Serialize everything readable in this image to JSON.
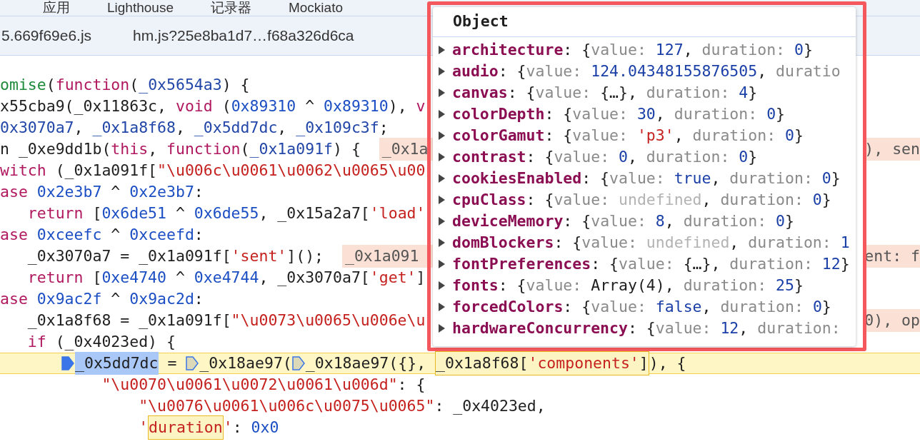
{
  "panel_tabs": [
    {
      "label": "应用"
    },
    {
      "label": "Lighthouse"
    },
    {
      "label": "记录器"
    },
    {
      "label": "Mockiato"
    }
  ],
  "file_tabs": [
    {
      "label": "5.669f69e6.js"
    },
    {
      "label": "hm.js?25e8ba1d7…f68a326d6ca"
    }
  ],
  "code_lines": [
    {
      "current": false,
      "tokens": [
        {
          "text": "omise",
          "kind": "func"
        },
        {
          "text": "(",
          "kind": "plain"
        },
        {
          "text": "function",
          "kind": "keyword"
        },
        {
          "text": "(",
          "kind": "plain"
        },
        {
          "text": "_0x5654a3",
          "kind": "def"
        },
        {
          "text": ") {",
          "kind": "plain"
        }
      ]
    },
    {
      "current": false,
      "tokens": [
        {
          "text": "x55cba9(_0x11863c, ",
          "kind": "plain"
        },
        {
          "text": "void",
          "kind": "keyword"
        },
        {
          "text": " (",
          "kind": "plain"
        },
        {
          "text": "0x89310",
          "kind": "number"
        },
        {
          "text": " ^ ",
          "kind": "plain"
        },
        {
          "text": "0x89310",
          "kind": "number"
        },
        {
          "text": "), ",
          "kind": "plain"
        },
        {
          "text": "v",
          "kind": "keyword"
        }
      ]
    },
    {
      "current": false,
      "tokens": [
        {
          "text": "0x3070a7",
          "kind": "def"
        },
        {
          "text": ", ",
          "kind": "plain"
        },
        {
          "text": "_0x1a8f68",
          "kind": "def"
        },
        {
          "text": ", ",
          "kind": "plain"
        },
        {
          "text": "_0x5dd7dc",
          "kind": "def"
        },
        {
          "text": ", ",
          "kind": "plain"
        },
        {
          "text": "_0x109c3f",
          "kind": "def"
        },
        {
          "text": ";",
          "kind": "plain"
        }
      ]
    },
    {
      "current": false,
      "tokens": [
        {
          "text": "n _0xe9dd1b(",
          "kind": "plain"
        },
        {
          "text": "this",
          "kind": "keyword"
        },
        {
          "text": ", ",
          "kind": "plain"
        },
        {
          "text": "function",
          "kind": "keyword"
        },
        {
          "text": "(",
          "kind": "plain"
        },
        {
          "text": "_0x1a091f",
          "kind": "def"
        },
        {
          "text": ") {  ",
          "kind": "plain"
        },
        {
          "text": "_0x1a",
          "kind": "inline"
        }
      ],
      "right": "), sen"
    },
    {
      "current": false,
      "tokens": [
        {
          "text": "witch",
          "kind": "keyword"
        },
        {
          "text": " (_0x1a091f[",
          "kind": "plain"
        },
        {
          "text": "\"\\u006c\\u0061\\u0062\\u0065\\u00",
          "kind": "string"
        }
      ]
    },
    {
      "current": false,
      "tokens": [
        {
          "text": "ase",
          "kind": "keyword"
        },
        {
          "text": " 0x2e3b7",
          "kind": "number"
        },
        {
          "text": " ^ ",
          "kind": "plain"
        },
        {
          "text": "0x2e3b7",
          "kind": "number"
        },
        {
          "text": ":",
          "kind": "plain"
        }
      ]
    },
    {
      "current": false,
      "tokens": [
        {
          "text": "   return",
          "kind": "keyword"
        },
        {
          "text": " [",
          "kind": "plain"
        },
        {
          "text": "0x6de51",
          "kind": "number"
        },
        {
          "text": " ^ ",
          "kind": "plain"
        },
        {
          "text": "0x6de55",
          "kind": "number"
        },
        {
          "text": ", _0x15a2a7[",
          "kind": "plain"
        },
        {
          "text": "'load'",
          "kind": "string"
        }
      ]
    },
    {
      "current": false,
      "tokens": [
        {
          "text": "ase",
          "kind": "keyword"
        },
        {
          "text": " 0xceefc",
          "kind": "number"
        },
        {
          "text": " ^ ",
          "kind": "plain"
        },
        {
          "text": "0xceefd",
          "kind": "number"
        },
        {
          "text": ":",
          "kind": "plain"
        }
      ]
    },
    {
      "current": false,
      "tokens": [
        {
          "text": "   _0x3070a7 = _0x1a091f[",
          "kind": "plain"
        },
        {
          "text": "'sent'",
          "kind": "string"
        },
        {
          "text": "]();  ",
          "kind": "plain"
        },
        {
          "text": "_0x1a091",
          "kind": "inline"
        }
      ],
      "right": "ent: f"
    },
    {
      "current": false,
      "tokens": [
        {
          "text": "   return",
          "kind": "keyword"
        },
        {
          "text": " [",
          "kind": "plain"
        },
        {
          "text": "0xe4740",
          "kind": "number"
        },
        {
          "text": " ^ ",
          "kind": "plain"
        },
        {
          "text": "0xe4744",
          "kind": "number"
        },
        {
          "text": ", _0x3070a7[",
          "kind": "plain"
        },
        {
          "text": "'get'",
          "kind": "string"
        },
        {
          "text": "]",
          "kind": "plain"
        }
      ]
    },
    {
      "current": false,
      "tokens": [
        {
          "text": "ase",
          "kind": "keyword"
        },
        {
          "text": " 0x9ac2f",
          "kind": "number"
        },
        {
          "text": " ^ ",
          "kind": "plain"
        },
        {
          "text": "0x9ac2d",
          "kind": "number"
        },
        {
          "text": ":",
          "kind": "plain"
        }
      ]
    },
    {
      "current": false,
      "tokens": [
        {
          "text": "   _0x1a8f68 = _0x1a091f[",
          "kind": "plain"
        },
        {
          "text": "\"\\u0073\\u0065\\u006e\\u",
          "kind": "string"
        }
      ],
      "right": "0), op"
    },
    {
      "current": false,
      "tokens": [
        {
          "text": "   if",
          "kind": "keyword"
        },
        {
          "text": " (_0x4023ed) {",
          "kind": "plain"
        }
      ]
    },
    {
      "current": true,
      "tokens": [
        {
          "kind": "exec-marker"
        },
        {
          "text": "_0x5dd7dc",
          "kind": "selected"
        },
        {
          "text": " = ",
          "kind": "plain"
        },
        {
          "kind": "marker"
        },
        {
          "text": "_0x18ae97(",
          "kind": "plain"
        },
        {
          "kind": "marker"
        },
        {
          "text": "_0x18ae97({}, ",
          "kind": "plain"
        },
        {
          "kind": "box",
          "tokens": [
            {
              "text": "_0x1a8f68[",
              "kind": "plain"
            },
            {
              "text": "'components'",
              "kind": "string"
            },
            {
              "text": "]",
              "kind": "plain"
            }
          ]
        },
        {
          "text": "), {",
          "kind": "plain"
        }
      ]
    },
    {
      "current": false,
      "tokens": [
        {
          "text": "           \"\\u0070\\u0061\\u0072\\u0061\\u006d\"",
          "kind": "string"
        },
        {
          "text": ": {",
          "kind": "plain"
        }
      ]
    },
    {
      "current": false,
      "tokens": [
        {
          "text": "               \"\\u0076\\u0061\\u006c\\u0075\\u0065\"",
          "kind": "string"
        },
        {
          "text": ": _0x4023ed,",
          "kind": "plain"
        }
      ]
    },
    {
      "current": false,
      "tokens": [
        {
          "text": "               '",
          "kind": "string"
        },
        {
          "kind": "box",
          "tokens": [
            {
              "text": "duration",
              "kind": "string"
            }
          ]
        },
        {
          "text": "'",
          "kind": "string"
        },
        {
          "text": ": ",
          "kind": "plain"
        },
        {
          "text": "0x0",
          "kind": "number"
        }
      ]
    }
  ],
  "popover": {
    "title": "Object",
    "rows": [
      {
        "name": "architecture",
        "tokens": [
          {
            "text": ": {",
            "kind": "plain"
          },
          {
            "text": "value: ",
            "kind": "grey"
          },
          {
            "text": "127",
            "kind": "num"
          },
          {
            "text": ", ",
            "kind": "plain"
          },
          {
            "text": "duration: ",
            "kind": "grey"
          },
          {
            "text": "0",
            "kind": "num"
          },
          {
            "text": "}",
            "kind": "plain"
          }
        ]
      },
      {
        "name": "audio",
        "tokens": [
          {
            "text": ": {",
            "kind": "plain"
          },
          {
            "text": "value: ",
            "kind": "grey"
          },
          {
            "text": "124.04348155876505",
            "kind": "num"
          },
          {
            "text": ", ",
            "kind": "plain"
          },
          {
            "text": "duratio",
            "kind": "grey"
          }
        ]
      },
      {
        "name": "canvas",
        "tokens": [
          {
            "text": ": {",
            "kind": "plain"
          },
          {
            "text": "value: ",
            "kind": "grey"
          },
          {
            "text": "{…}",
            "kind": "plain"
          },
          {
            "text": ", ",
            "kind": "plain"
          },
          {
            "text": "duration: ",
            "kind": "grey"
          },
          {
            "text": "4",
            "kind": "num"
          },
          {
            "text": "}",
            "kind": "plain"
          }
        ]
      },
      {
        "name": "colorDepth",
        "tokens": [
          {
            "text": ": {",
            "kind": "plain"
          },
          {
            "text": "value: ",
            "kind": "grey"
          },
          {
            "text": "30",
            "kind": "num"
          },
          {
            "text": ", ",
            "kind": "plain"
          },
          {
            "text": "duration: ",
            "kind": "grey"
          },
          {
            "text": "0",
            "kind": "num"
          },
          {
            "text": "}",
            "kind": "plain"
          }
        ]
      },
      {
        "name": "colorGamut",
        "tokens": [
          {
            "text": ": {",
            "kind": "plain"
          },
          {
            "text": "value: ",
            "kind": "grey"
          },
          {
            "text": "'p3'",
            "kind": "str"
          },
          {
            "text": ", ",
            "kind": "plain"
          },
          {
            "text": "duration: ",
            "kind": "grey"
          },
          {
            "text": "0",
            "kind": "num"
          },
          {
            "text": "}",
            "kind": "plain"
          }
        ]
      },
      {
        "name": "contrast",
        "tokens": [
          {
            "text": ": {",
            "kind": "plain"
          },
          {
            "text": "value: ",
            "kind": "grey"
          },
          {
            "text": "0",
            "kind": "num"
          },
          {
            "text": ", ",
            "kind": "plain"
          },
          {
            "text": "duration: ",
            "kind": "grey"
          },
          {
            "text": "0",
            "kind": "num"
          },
          {
            "text": "}",
            "kind": "plain"
          }
        ]
      },
      {
        "name": "cookiesEnabled",
        "tokens": [
          {
            "text": ": {",
            "kind": "plain"
          },
          {
            "text": "value: ",
            "kind": "grey"
          },
          {
            "text": "true",
            "kind": "num"
          },
          {
            "text": ", ",
            "kind": "plain"
          },
          {
            "text": "duration: ",
            "kind": "grey"
          },
          {
            "text": "0",
            "kind": "num"
          },
          {
            "text": "}",
            "kind": "plain"
          }
        ]
      },
      {
        "name": "cpuClass",
        "tokens": [
          {
            "text": ": {",
            "kind": "plain"
          },
          {
            "text": "value: ",
            "kind": "grey"
          },
          {
            "text": "undefined",
            "kind": "undef"
          },
          {
            "text": ", ",
            "kind": "plain"
          },
          {
            "text": "duration: ",
            "kind": "grey"
          },
          {
            "text": "0",
            "kind": "num"
          },
          {
            "text": "}",
            "kind": "plain"
          }
        ]
      },
      {
        "name": "deviceMemory",
        "tokens": [
          {
            "text": ": {",
            "kind": "plain"
          },
          {
            "text": "value: ",
            "kind": "grey"
          },
          {
            "text": "8",
            "kind": "num"
          },
          {
            "text": ", ",
            "kind": "plain"
          },
          {
            "text": "duration: ",
            "kind": "grey"
          },
          {
            "text": "0",
            "kind": "num"
          },
          {
            "text": "}",
            "kind": "plain"
          }
        ]
      },
      {
        "name": "domBlockers",
        "tokens": [
          {
            "text": ": {",
            "kind": "plain"
          },
          {
            "text": "value: ",
            "kind": "grey"
          },
          {
            "text": "undefined",
            "kind": "undef"
          },
          {
            "text": ", ",
            "kind": "plain"
          },
          {
            "text": "duration: ",
            "kind": "grey"
          },
          {
            "text": "1",
            "kind": "num"
          }
        ]
      },
      {
        "name": "fontPreferences",
        "tokens": [
          {
            "text": ": {",
            "kind": "plain"
          },
          {
            "text": "value: ",
            "kind": "grey"
          },
          {
            "text": "{…}",
            "kind": "plain"
          },
          {
            "text": ", ",
            "kind": "plain"
          },
          {
            "text": "duration: ",
            "kind": "grey"
          },
          {
            "text": "12",
            "kind": "num"
          },
          {
            "text": "}",
            "kind": "plain"
          }
        ]
      },
      {
        "name": "fonts",
        "tokens": [
          {
            "text": ": {",
            "kind": "plain"
          },
          {
            "text": "value: ",
            "kind": "grey"
          },
          {
            "text": "Array(4)",
            "kind": "plain"
          },
          {
            "text": ", ",
            "kind": "plain"
          },
          {
            "text": "duration: ",
            "kind": "grey"
          },
          {
            "text": "25",
            "kind": "num"
          },
          {
            "text": "}",
            "kind": "plain"
          }
        ]
      },
      {
        "name": "forcedColors",
        "tokens": [
          {
            "text": ": {",
            "kind": "plain"
          },
          {
            "text": "value: ",
            "kind": "grey"
          },
          {
            "text": "false",
            "kind": "num"
          },
          {
            "text": ", ",
            "kind": "plain"
          },
          {
            "text": "duration: ",
            "kind": "grey"
          },
          {
            "text": "0",
            "kind": "num"
          },
          {
            "text": "}",
            "kind": "plain"
          }
        ]
      },
      {
        "name": "hardwareConcurrency",
        "tokens": [
          {
            "text": ": {",
            "kind": "plain"
          },
          {
            "text": "value: ",
            "kind": "grey"
          },
          {
            "text": "12",
            "kind": "num"
          },
          {
            "text": ", ",
            "kind": "plain"
          },
          {
            "text": "duration:",
            "kind": "grey"
          }
        ]
      }
    ]
  }
}
